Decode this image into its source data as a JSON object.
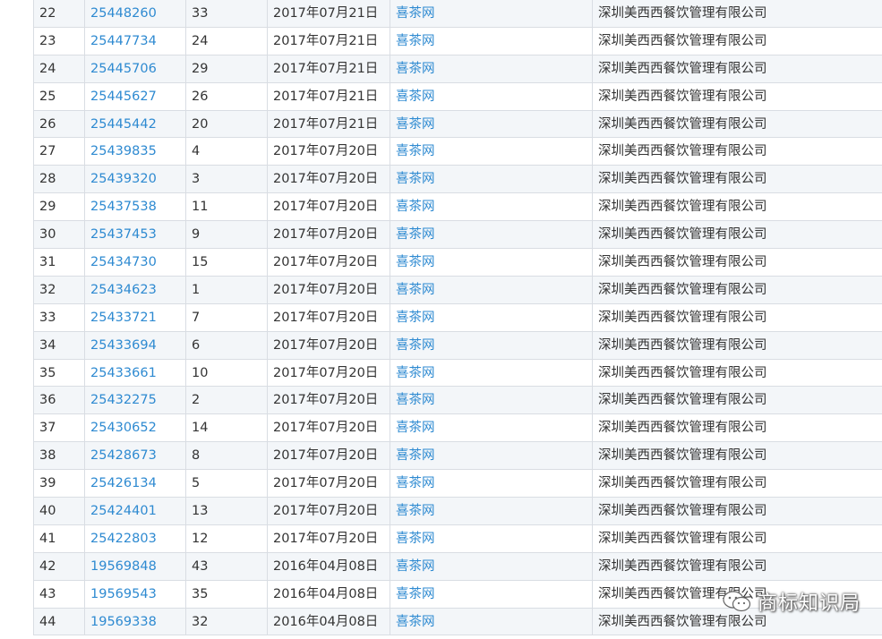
{
  "table": {
    "rows": [
      {
        "seq": "22",
        "reg": "25448260",
        "cls": "33",
        "date": "2017年07月21日",
        "mark": "喜茶网",
        "owner": "深圳美西西餐饮管理有限公司"
      },
      {
        "seq": "23",
        "reg": "25447734",
        "cls": "24",
        "date": "2017年07月21日",
        "mark": "喜茶网",
        "owner": "深圳美西西餐饮管理有限公司"
      },
      {
        "seq": "24",
        "reg": "25445706",
        "cls": "29",
        "date": "2017年07月21日",
        "mark": "喜茶网",
        "owner": "深圳美西西餐饮管理有限公司"
      },
      {
        "seq": "25",
        "reg": "25445627",
        "cls": "26",
        "date": "2017年07月21日",
        "mark": "喜茶网",
        "owner": "深圳美西西餐饮管理有限公司"
      },
      {
        "seq": "26",
        "reg": "25445442",
        "cls": "20",
        "date": "2017年07月21日",
        "mark": "喜茶网",
        "owner": "深圳美西西餐饮管理有限公司"
      },
      {
        "seq": "27",
        "reg": "25439835",
        "cls": "4",
        "date": "2017年07月20日",
        "mark": "喜茶网",
        "owner": "深圳美西西餐饮管理有限公司"
      },
      {
        "seq": "28",
        "reg": "25439320",
        "cls": "3",
        "date": "2017年07月20日",
        "mark": "喜茶网",
        "owner": "深圳美西西餐饮管理有限公司"
      },
      {
        "seq": "29",
        "reg": "25437538",
        "cls": "11",
        "date": "2017年07月20日",
        "mark": "喜茶网",
        "owner": "深圳美西西餐饮管理有限公司"
      },
      {
        "seq": "30",
        "reg": "25437453",
        "cls": "9",
        "date": "2017年07月20日",
        "mark": "喜茶网",
        "owner": "深圳美西西餐饮管理有限公司"
      },
      {
        "seq": "31",
        "reg": "25434730",
        "cls": "15",
        "date": "2017年07月20日",
        "mark": "喜茶网",
        "owner": "深圳美西西餐饮管理有限公司"
      },
      {
        "seq": "32",
        "reg": "25434623",
        "cls": "1",
        "date": "2017年07月20日",
        "mark": "喜茶网",
        "owner": "深圳美西西餐饮管理有限公司"
      },
      {
        "seq": "33",
        "reg": "25433721",
        "cls": "7",
        "date": "2017年07月20日",
        "mark": "喜茶网",
        "owner": "深圳美西西餐饮管理有限公司"
      },
      {
        "seq": "34",
        "reg": "25433694",
        "cls": "6",
        "date": "2017年07月20日",
        "mark": "喜茶网",
        "owner": "深圳美西西餐饮管理有限公司"
      },
      {
        "seq": "35",
        "reg": "25433661",
        "cls": "10",
        "date": "2017年07月20日",
        "mark": "喜茶网",
        "owner": "深圳美西西餐饮管理有限公司"
      },
      {
        "seq": "36",
        "reg": "25432275",
        "cls": "2",
        "date": "2017年07月20日",
        "mark": "喜茶网",
        "owner": "深圳美西西餐饮管理有限公司"
      },
      {
        "seq": "37",
        "reg": "25430652",
        "cls": "14",
        "date": "2017年07月20日",
        "mark": "喜茶网",
        "owner": "深圳美西西餐饮管理有限公司"
      },
      {
        "seq": "38",
        "reg": "25428673",
        "cls": "8",
        "date": "2017年07月20日",
        "mark": "喜茶网",
        "owner": "深圳美西西餐饮管理有限公司"
      },
      {
        "seq": "39",
        "reg": "25426134",
        "cls": "5",
        "date": "2017年07月20日",
        "mark": "喜茶网",
        "owner": "深圳美西西餐饮管理有限公司"
      },
      {
        "seq": "40",
        "reg": "25424401",
        "cls": "13",
        "date": "2017年07月20日",
        "mark": "喜茶网",
        "owner": "深圳美西西餐饮管理有限公司"
      },
      {
        "seq": "41",
        "reg": "25422803",
        "cls": "12",
        "date": "2017年07月20日",
        "mark": "喜茶网",
        "owner": "深圳美西西餐饮管理有限公司"
      },
      {
        "seq": "42",
        "reg": "19569848",
        "cls": "43",
        "date": "2016年04月08日",
        "mark": "喜茶网",
        "owner": "深圳美西西餐饮管理有限公司"
      },
      {
        "seq": "43",
        "reg": "19569543",
        "cls": "35",
        "date": "2016年04月08日",
        "mark": "喜茶网",
        "owner": "深圳美西西餐饮管理有限公司"
      },
      {
        "seq": "44",
        "reg": "19569338",
        "cls": "32",
        "date": "2016年04月08日",
        "mark": "喜茶网",
        "owner": "深圳美西西餐饮管理有限公司"
      }
    ]
  },
  "watermark": {
    "text": "商标知识局",
    "icon": "wechat-icon"
  },
  "colors": {
    "link": "#2e8ad1",
    "text": "#333333",
    "row_alt": "#f3f6f9",
    "border": "#d9dde3"
  }
}
